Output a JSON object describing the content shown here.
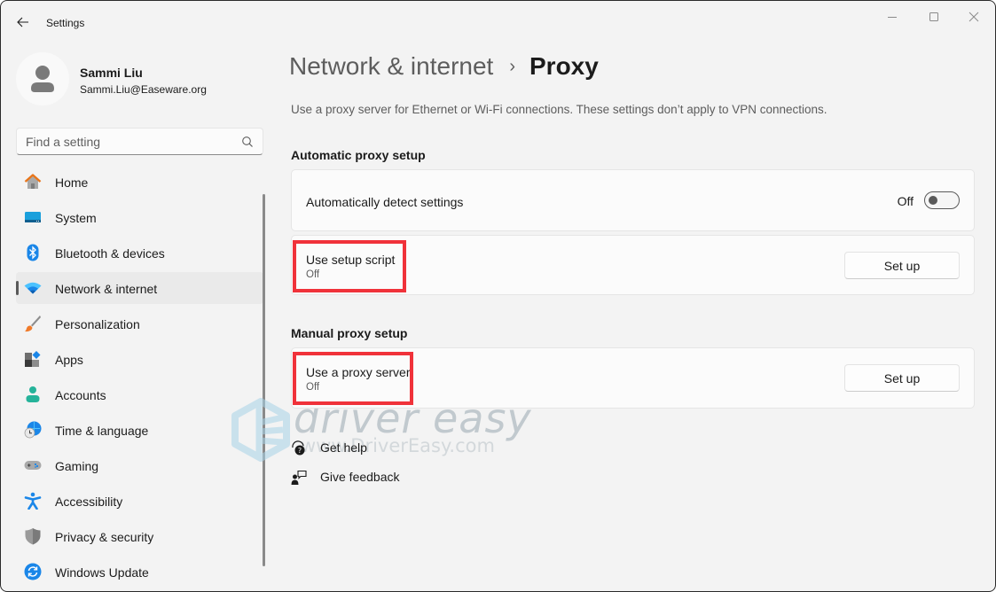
{
  "window": {
    "app_title": "Settings",
    "controls": {
      "minimize": "minimize",
      "maximize": "maximize",
      "close": "close"
    }
  },
  "profile": {
    "name": "Sammi Liu",
    "email": "Sammi.Liu@Easeware.org"
  },
  "search": {
    "placeholder": "Find a setting",
    "value": ""
  },
  "sidebar": {
    "items": [
      {
        "label": "Home",
        "icon": "home-icon",
        "active": false
      },
      {
        "label": "System",
        "icon": "system-icon",
        "active": false
      },
      {
        "label": "Bluetooth & devices",
        "icon": "bluetooth-icon",
        "active": false
      },
      {
        "label": "Network & internet",
        "icon": "wifi-icon",
        "active": true
      },
      {
        "label": "Personalization",
        "icon": "brush-icon",
        "active": false
      },
      {
        "label": "Apps",
        "icon": "apps-icon",
        "active": false
      },
      {
        "label": "Accounts",
        "icon": "accounts-icon",
        "active": false
      },
      {
        "label": "Time & language",
        "icon": "time-language-icon",
        "active": false
      },
      {
        "label": "Gaming",
        "icon": "gamepad-icon",
        "active": false
      },
      {
        "label": "Accessibility",
        "icon": "accessibility-icon",
        "active": false
      },
      {
        "label": "Privacy & security",
        "icon": "shield-icon",
        "active": false
      },
      {
        "label": "Windows Update",
        "icon": "update-icon",
        "active": false
      }
    ]
  },
  "main": {
    "breadcrumb": {
      "parent": "Network & internet",
      "separator": "›",
      "current": "Proxy"
    },
    "description": "Use a proxy server for Ethernet or Wi-Fi connections. These settings don’t apply to VPN connections.",
    "automatic": {
      "title": "Automatic proxy setup",
      "detect": {
        "label": "Automatically detect settings",
        "state_label": "Off",
        "on": false
      },
      "script": {
        "label": "Use setup script",
        "status": "Off",
        "button": "Set up"
      }
    },
    "manual": {
      "title": "Manual proxy setup",
      "proxy": {
        "label": "Use a proxy server",
        "status": "Off",
        "button": "Set up"
      }
    },
    "links": [
      {
        "label": "Get help",
        "icon": "help-icon"
      },
      {
        "label": "Give feedback",
        "icon": "feedback-icon"
      }
    ]
  },
  "watermark": {
    "brand": "driver easy",
    "url": "www.DriverEasy.com"
  },
  "colors": {
    "highlight": "#f0323a",
    "accent": "#0067c0",
    "background": "#f3f3f3"
  }
}
